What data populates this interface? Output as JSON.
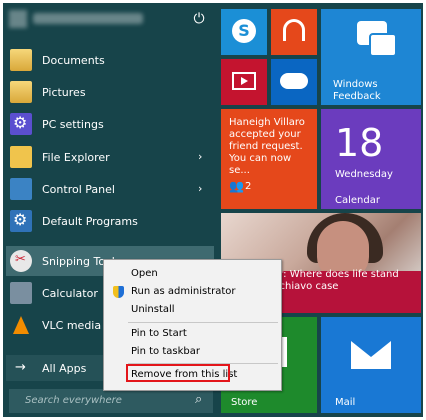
{
  "power_icon": "power-icon",
  "left_items": [
    {
      "label": "Documents",
      "icon": "documents-folder-icon",
      "arrow": false
    },
    {
      "label": "Pictures",
      "icon": "pictures-folder-icon",
      "arrow": false
    },
    {
      "label": "PC settings",
      "icon": "gear-icon",
      "arrow": false
    },
    {
      "label": "File Explorer",
      "icon": "file-explorer-icon",
      "arrow": true
    },
    {
      "label": "Control Panel",
      "icon": "control-panel-icon",
      "arrow": true
    },
    {
      "label": "Default Programs",
      "icon": "default-programs-icon",
      "arrow": false
    },
    {
      "label": "Snipping Tool",
      "icon": "snipping-tool-icon",
      "arrow": false
    },
    {
      "label": "Calculator",
      "icon": "calculator-icon",
      "arrow": false
    },
    {
      "label": "VLC media play",
      "icon": "vlc-icon",
      "arrow": false
    }
  ],
  "arrow_glyph": "›",
  "all_apps": {
    "arrow": "→",
    "label": "All Apps"
  },
  "search": {
    "placeholder": "Search everywhere",
    "icon": "search-icon"
  },
  "tiles": {
    "skype": {
      "icon": "skype-icon"
    },
    "music": {
      "icon": "headphones-icon"
    },
    "video": {
      "icon": "video-icon"
    },
    "onedrive": {
      "icon": "cloud-icon"
    },
    "feedback": {
      "name": "Windows\nFeedback"
    },
    "people": {
      "text": "Haneigh Villaro accepted your friend request. You can now se...",
      "count": "2",
      "icon": "people-icon"
    },
    "calendar": {
      "day_number": "18",
      "weekday": "Wednesday",
      "name": "Calendar"
    },
    "news": {
      "headline": "years after: Where does life stand the Terri Schiavo case"
    },
    "store": {
      "name": "Store"
    },
    "mail": {
      "name": "Mail"
    }
  },
  "context_menu": {
    "items": [
      "Open",
      "Run as administrator",
      "Uninstall",
      "Pin to Start",
      "Pin to taskbar",
      "Remove from this list"
    ]
  },
  "colors": {
    "start_bg": "#17444a",
    "highlight_red": "#e3151a"
  }
}
